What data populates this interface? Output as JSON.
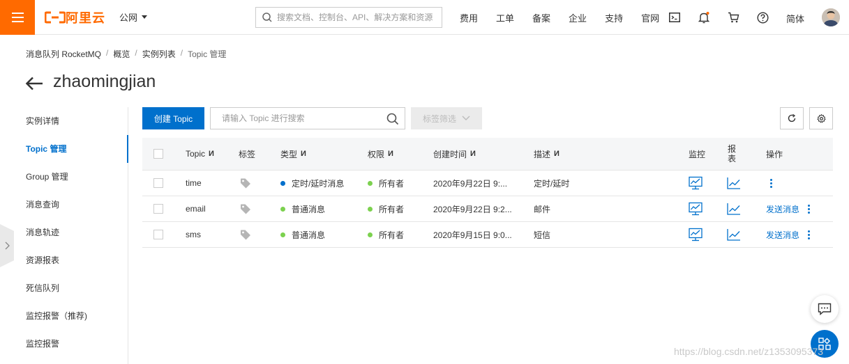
{
  "colors": {
    "brand": "#ff6a00",
    "primary": "#0070cc",
    "dot_blue": "#0070cc",
    "dot_green": "#7cd14f"
  },
  "topbar": {
    "brand_name": "阿里云",
    "region": "公网",
    "search_placeholder": "搜索文档、控制台、API、解决方案和资源",
    "nav": [
      "费用",
      "工单",
      "备案",
      "企业",
      "支持",
      "官网"
    ],
    "lang": "简体"
  },
  "breadcrumb": [
    "消息队列 RocketMQ",
    "概览",
    "实例列表",
    "Topic 管理"
  ],
  "page_title": "zhaomingjian",
  "sidebar": {
    "items": [
      {
        "label": "实例详情"
      },
      {
        "label": "Topic 管理",
        "active": true
      },
      {
        "label": "Group 管理"
      },
      {
        "label": "消息查询"
      },
      {
        "label": "消息轨迹"
      },
      {
        "label": "资源报表"
      },
      {
        "label": "死信队列"
      },
      {
        "label": "监控报警（推荐)"
      },
      {
        "label": "监控报警"
      }
    ]
  },
  "toolbar": {
    "create_label": "创建 Topic",
    "search_placeholder": "请输入 Topic 进行搜索",
    "tag_filter_label": "标签筛选"
  },
  "table": {
    "headers": {
      "topic": "Topic",
      "tag": "标签",
      "type": "类型",
      "perm": "权限",
      "created": "创建时间",
      "desc": "描述",
      "monitor": "监控",
      "report_1": "报",
      "report_2": "表",
      "ops": "操作"
    },
    "sort_glyph": "И",
    "rows": [
      {
        "topic": "time",
        "type": "定时/延时消息",
        "type_dot": "blue",
        "perm": "所有者",
        "created": "2020年9月22日 9:...",
        "desc": "定时/延时",
        "send": ""
      },
      {
        "topic": "email",
        "type": "普通消息",
        "type_dot": "green",
        "perm": "所有者",
        "created": "2020年9月22日 9:2...",
        "desc": "邮件",
        "send": "发送消息"
      },
      {
        "topic": "sms",
        "type": "普通消息",
        "type_dot": "green",
        "perm": "所有者",
        "created": "2020年9月15日 9:0...",
        "desc": "短信",
        "send": "发送消息"
      }
    ]
  },
  "watermark": "https://blog.csdn.net/z1353095373"
}
